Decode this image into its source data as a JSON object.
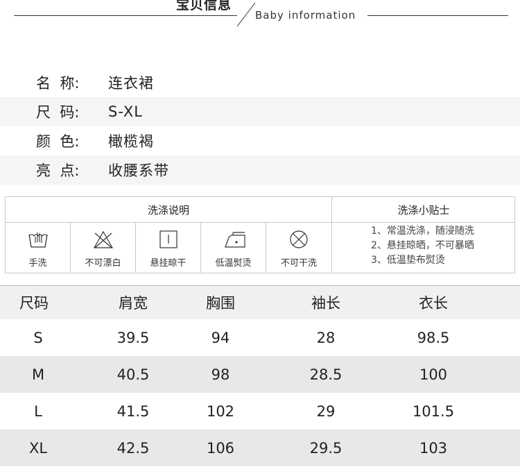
{
  "header": {
    "title_cn": "宝贝信息",
    "title_en": "Baby information"
  },
  "info": [
    {
      "label": "名  称:",
      "value": "连衣裙"
    },
    {
      "label": "尺  码:",
      "value": "S-XL"
    },
    {
      "label": "颜  色:",
      "value": "橄榄褐"
    },
    {
      "label": "亮  点:",
      "value": "收腰系带"
    }
  ],
  "wash": {
    "left_title": "洗涤说明",
    "right_title": "洗涤小贴士",
    "icons": [
      {
        "icon": "hand-wash-icon",
        "label": "手洗"
      },
      {
        "icon": "no-bleach-icon",
        "label": "不可漂白"
      },
      {
        "icon": "hang-dry-icon",
        "label": "悬挂晾干"
      },
      {
        "icon": "low-iron-icon",
        "label": "低温熨烫"
      },
      {
        "icon": "no-tumble-dry-icon",
        "label": "不可干洗"
      }
    ],
    "tips": [
      "1、常温洗涤，随浸随洗",
      "2、悬挂晾晒，不可暴晒",
      "3、低温垫布熨烫"
    ]
  },
  "size_table": {
    "headers": [
      "尺码",
      "肩宽",
      "胸围",
      "袖长",
      "衣长"
    ],
    "rows": [
      [
        "S",
        "39.5",
        "94",
        "28",
        "98.5"
      ],
      [
        "M",
        "40.5",
        "98",
        "28.5",
        "100"
      ],
      [
        "L",
        "41.5",
        "102",
        "29",
        "101.5"
      ],
      [
        "XL",
        "42.5",
        "106",
        "29.5",
        "103"
      ]
    ]
  }
}
